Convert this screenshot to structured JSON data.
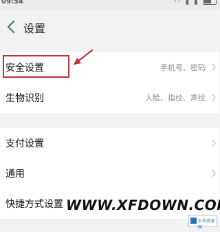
{
  "status_bar": {
    "time": "09:54",
    "battery_level": "62"
  },
  "header": {
    "title": "设置"
  },
  "settings": [
    {
      "label": "安全设置",
      "value": "手机号、密码"
    },
    {
      "label": "生物识别",
      "value": "人脸、指纹、声纹"
    },
    {
      "label": "支付设置",
      "value": ""
    },
    {
      "label": "通用",
      "value": ""
    },
    {
      "label": "快捷方式设置",
      "value": ""
    }
  ],
  "annotation": {
    "highlight_color": "#c0303a"
  },
  "watermark": {
    "text": "WWW.XFDOWN.COM",
    "logo_text": "五号资源网"
  },
  "colors": {
    "background": "#f2f2f2",
    "card": "#ffffff",
    "secondary_text": "#8a8a8a"
  }
}
